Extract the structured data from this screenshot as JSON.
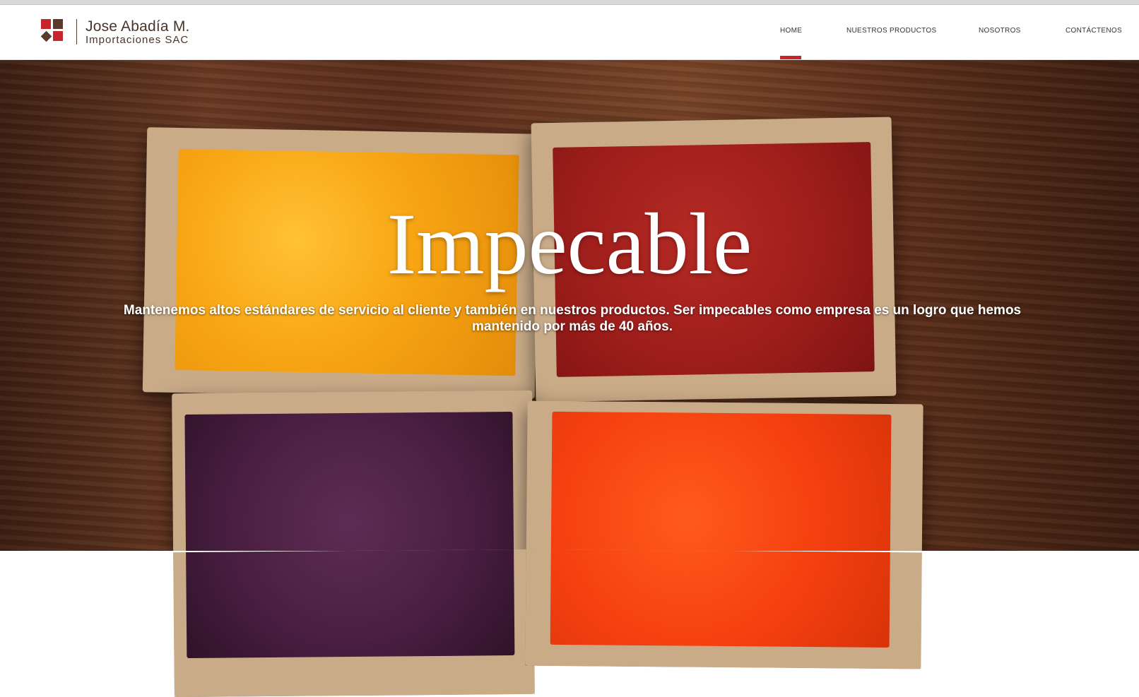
{
  "brand": {
    "name": "Jose Abadía M.",
    "subtitle": "Importaciones SAC"
  },
  "nav": {
    "items": [
      {
        "label": "HOME",
        "active": true
      },
      {
        "label": "NUESTROS PRODUCTOS",
        "active": false
      },
      {
        "label": "NOSOTROS",
        "active": false
      },
      {
        "label": "CONTÁCTENOS",
        "active": false
      }
    ],
    "active_color": "#c8242b"
  },
  "hero": {
    "title": "Impecable",
    "subtitle": "Mantenemos altos estándares de servicio al cliente y también en nuestros productos. Ser impecables como empresa es un logro que hemos mantenido por más de 40 años."
  },
  "colors": {
    "brand_red": "#c8242b",
    "brand_brown": "#5a3a2a",
    "powder_yellow": "#f8a514",
    "powder_red": "#9e1e1b",
    "powder_purple": "#4a1f42",
    "powder_orange": "#f5400f"
  }
}
